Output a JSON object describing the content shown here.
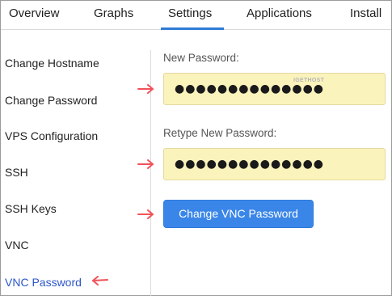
{
  "tabs": [
    {
      "label": "Overview"
    },
    {
      "label": "Graphs"
    },
    {
      "label": "Settings",
      "active": true
    },
    {
      "label": "Applications"
    },
    {
      "label": "Install"
    }
  ],
  "sidebar": {
    "items": [
      {
        "label": "Change Hostname"
      },
      {
        "label": "Change Password"
      },
      {
        "label": "VPS Configuration"
      },
      {
        "label": "SSH"
      },
      {
        "label": "SSH Keys"
      },
      {
        "label": "VNC"
      },
      {
        "label": "VNC Password",
        "active": true
      }
    ]
  },
  "form": {
    "new_password_label": "New Password:",
    "new_password_value": "●●●●●●●●●●●●●●",
    "retype_password_label": "Retype New Password:",
    "retype_password_value": "●●●●●●●●●●●●●●",
    "submit_label": "Change VNC Password"
  },
  "watermark": "IGETHOST",
  "colors": {
    "accent": "#2f7bd6",
    "button": "#3a86e8",
    "input_bg": "#fbf3bc",
    "active_link": "#2d57c9",
    "annotation_arrow": "#f0525a"
  },
  "annotations": {
    "arrow_icon": "red-arrow-icon"
  }
}
